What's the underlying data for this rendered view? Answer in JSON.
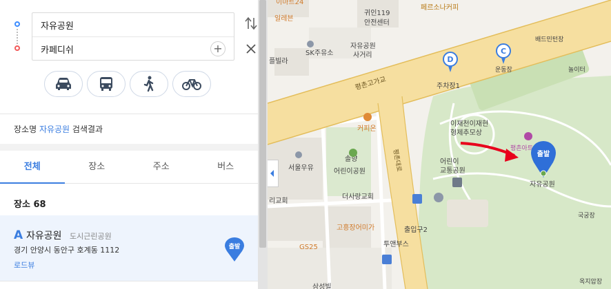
{
  "route": {
    "origin": "자유공원",
    "destination": "카페디쉬",
    "add_waypoint": "+"
  },
  "modes": [
    {
      "icon": "car-icon"
    },
    {
      "icon": "bus-icon"
    },
    {
      "icon": "walk-icon"
    },
    {
      "icon": "bicycle-icon"
    }
  ],
  "search_summary": {
    "prefix": "장소명 ",
    "keyword": "자유공원",
    "suffix": " 검색결과"
  },
  "tabs": [
    "전체",
    "장소",
    "주소",
    "버스"
  ],
  "place_count": {
    "label": "장소",
    "count": "68"
  },
  "result": {
    "letter": "A",
    "name": "자유공원",
    "category": "도시근린공원",
    "address": "경기 안양시 동안구 호계동 1112",
    "roadview": "로드뷰",
    "pin_label": "출발"
  },
  "map": {
    "labels": {
      "e_mart": "이마트24",
      "tile": "일레븐",
      "police": "귀인119",
      "police2": "안전센터",
      "pericana": "페르소나커피",
      "badminton": "배드민턴장",
      "sk": "SK주유소",
      "freevilla": "플빌라",
      "jayu_intersection": "자유공원",
      "jayu_intersection2": "사거리",
      "highway": "평촌고가교",
      "parking_d": "주차장1",
      "sports": "운동장",
      "playground": "놀이터",
      "coffee": "커피온",
      "memorial1": "이재천이재현",
      "memorial2": "형제추모상",
      "kids_park1": "어린이",
      "kids_park2": "교통공원",
      "pyeongchon_road": "평촌대로",
      "songhwa1": "솔향",
      "songhwa2": "어린이공원",
      "seoul_milk": "서울우유",
      "church1": "리교회",
      "church2": "더사랑교회",
      "pier": "고흥장어미가",
      "gs25": "GS25",
      "exit2": "출입구2",
      "twin": "투앤부스",
      "archery": "국궁장",
      "oak": "옥지압장",
      "park_name": "자유공원",
      "start_pin": "출발",
      "zone": "평촌아트",
      "apartment": "삼성빌"
    },
    "markers": {
      "d": "D",
      "c": "C"
    }
  },
  "colors": {
    "accent": "#3a7de0",
    "park": "#d7e8c8",
    "road_main": "#f2d58a",
    "road_edge": "#e3bd5a",
    "arrow": "#e8001c"
  }
}
